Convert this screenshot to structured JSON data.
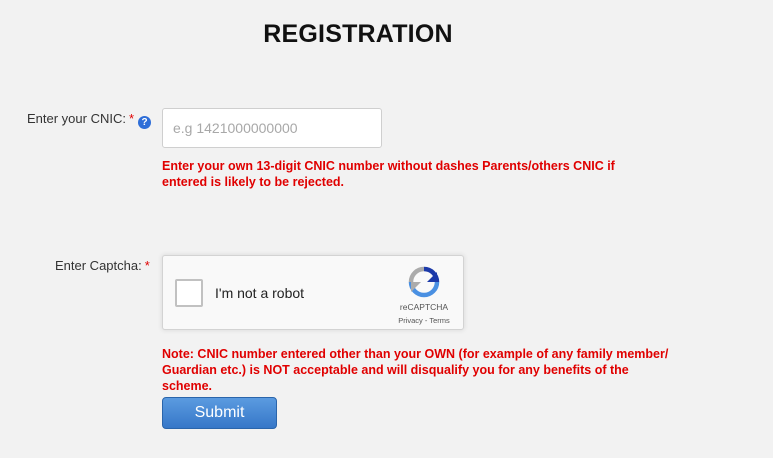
{
  "page": {
    "title": "REGISTRATION"
  },
  "cnic": {
    "label": "Enter your CNIC:",
    "required_mark": "*",
    "help_icon": "?",
    "placeholder": "e.g 1421000000000",
    "value": "",
    "hint": "Enter your own 13-digit CNIC number without dashes Parents/others CNIC if entered is likely to be rejected."
  },
  "captcha": {
    "label": "Enter Captcha:",
    "required_mark": "*",
    "checkbox_label": "I'm not a robot",
    "brand": "reCAPTCHA",
    "privacy": "Privacy",
    "separator": " - ",
    "terms": "Terms",
    "logo_icon": "recaptcha-logo-icon"
  },
  "note": {
    "text": "Note: CNIC number entered other than your OWN (for example of any family member/ Guardian etc.) is NOT acceptable and will disqualify you for any benefits of the scheme."
  },
  "submit": {
    "label": "Submit"
  },
  "colors": {
    "background": "#f2f2f2",
    "error": "#e00000",
    "button": "#3677c8",
    "help_icon": "#2e6ed8"
  }
}
